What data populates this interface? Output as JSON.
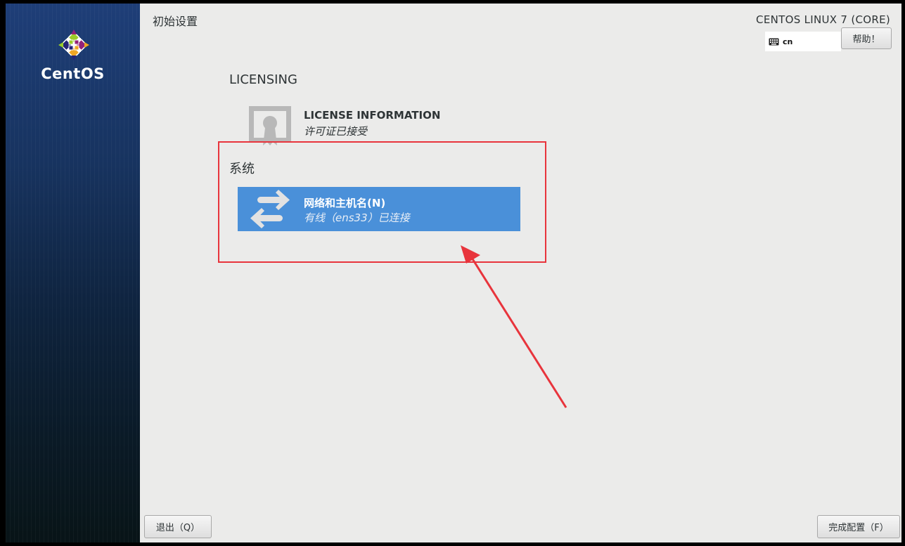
{
  "brand": {
    "name": "CentOS"
  },
  "header": {
    "page_title": "初始设置",
    "product_title": "CENTOS LINUX 7 (CORE)",
    "keyboard_layout": "cn",
    "help_label": "帮助！"
  },
  "sections": {
    "licensing": {
      "title": "LICENSING",
      "spoke": {
        "title": "LICENSE INFORMATION",
        "status": "许可证已接受",
        "icon": "certificate-icon"
      }
    },
    "system": {
      "title": "系统",
      "spoke": {
        "title": "网络和主机名(N)",
        "status": "有线（ens33）已连接",
        "icon": "network-arrows-icon"
      }
    }
  },
  "footer": {
    "quit_label": "退出（Q）",
    "finish_label": "完成配置（F）"
  },
  "colors": {
    "sidebar": "#1e3e78",
    "selected_tile": "#4a90d9",
    "annotation": "#e8343c",
    "background": "#ebebea"
  }
}
